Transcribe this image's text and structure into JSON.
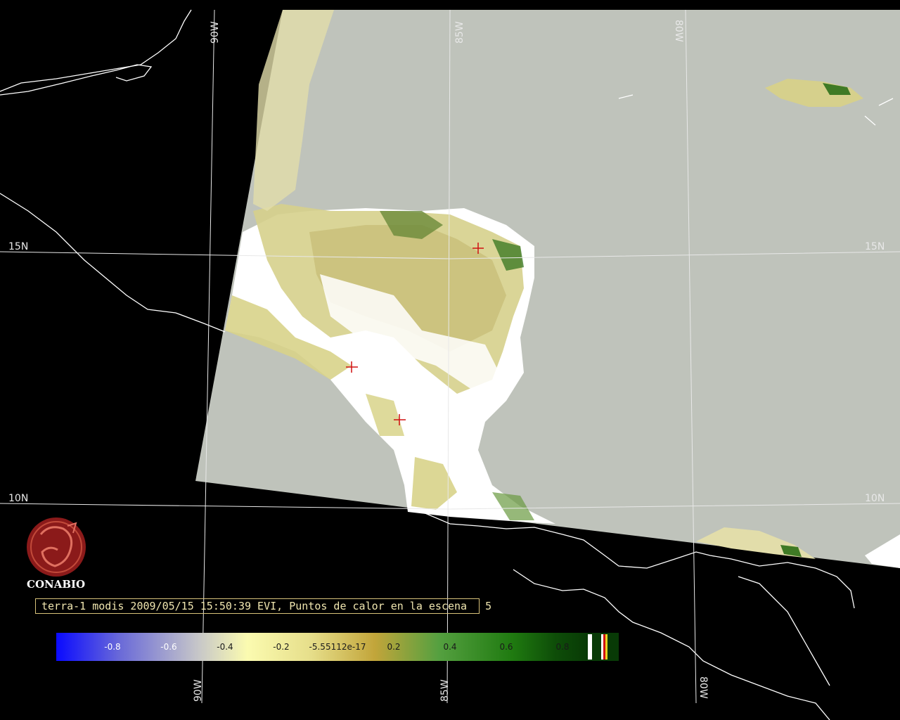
{
  "map": {
    "logo_text": "CONABIO",
    "caption_main": "terra-1 modis 2009/05/15 15:50:39 EVI, Puntos de calor en la escena",
    "caption_count": "5",
    "longitude_labels": [
      "90W",
      "85W",
      "80W"
    ],
    "latitude_labels": [
      "15N",
      "10N"
    ],
    "colorbar_ticks": [
      "-0.8",
      "-0.6",
      "-0.4",
      "-0.2",
      "-5.55112e-17",
      "0.2",
      "0.4",
      "0.6",
      "0.8"
    ],
    "hotspot_count": 3
  },
  "colors": {
    "background": "#000000",
    "ocean_swath": "#bfc3bb",
    "cloud": "#ffffff",
    "vegetation_low": "#d8d38a",
    "vegetation_high": "#2f7a1a",
    "gridline": "#e8e8e8",
    "coastline": "#ffffff",
    "hotspot": "#d01010",
    "logo": "#8b1a1a",
    "caption_border": "#d8c27a"
  }
}
